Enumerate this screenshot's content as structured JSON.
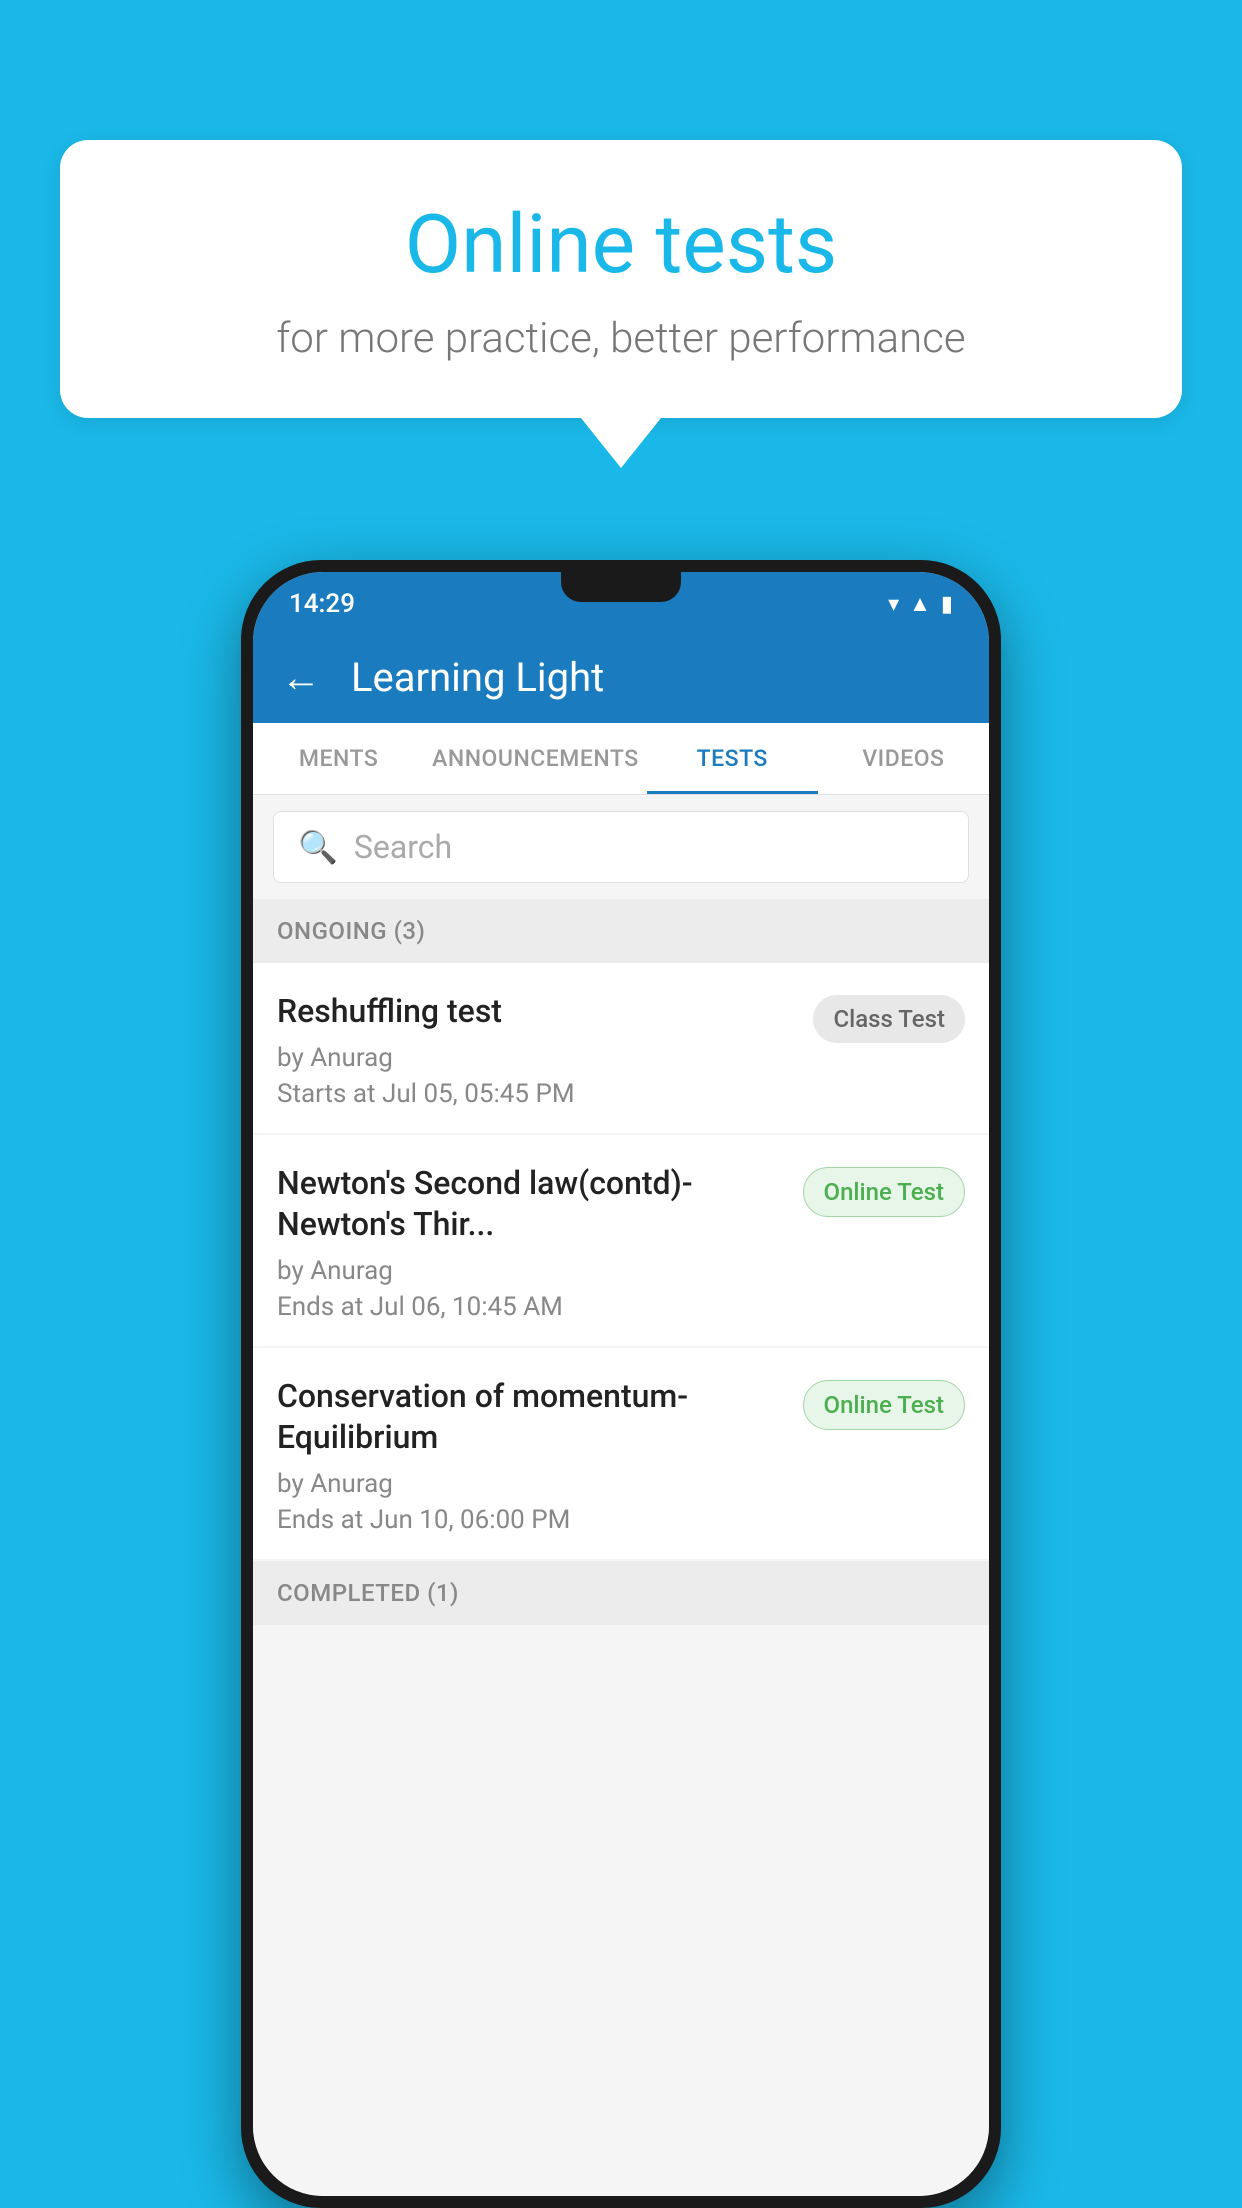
{
  "background": {
    "color": "#1ab8e8"
  },
  "bubble": {
    "title": "Online tests",
    "subtitle": "for more practice, better performance"
  },
  "phone": {
    "status_bar": {
      "time": "14:29",
      "icons": [
        "wifi",
        "signal",
        "battery"
      ]
    },
    "header": {
      "back_label": "←",
      "title": "Learning Light"
    },
    "tabs": [
      {
        "label": "MENTS",
        "active": false
      },
      {
        "label": "ANNOUNCEMENTS",
        "active": false
      },
      {
        "label": "TESTS",
        "active": true
      },
      {
        "label": "VIDEOS",
        "active": false
      }
    ],
    "search": {
      "placeholder": "Search"
    },
    "sections": [
      {
        "title": "ONGOING (3)",
        "items": [
          {
            "name": "Reshuffling test",
            "by": "by Anurag",
            "date": "Starts at  Jul 05, 05:45 PM",
            "badge": "Class Test",
            "badge_type": "class"
          },
          {
            "name": "Newton's Second law(contd)-Newton's Thir...",
            "by": "by Anurag",
            "date": "Ends at  Jul 06, 10:45 AM",
            "badge": "Online Test",
            "badge_type": "online"
          },
          {
            "name": "Conservation of momentum-Equilibrium",
            "by": "by Anurag",
            "date": "Ends at  Jun 10, 06:00 PM",
            "badge": "Online Test",
            "badge_type": "online"
          }
        ]
      }
    ],
    "completed_section": {
      "title": "COMPLETED (1)"
    }
  }
}
